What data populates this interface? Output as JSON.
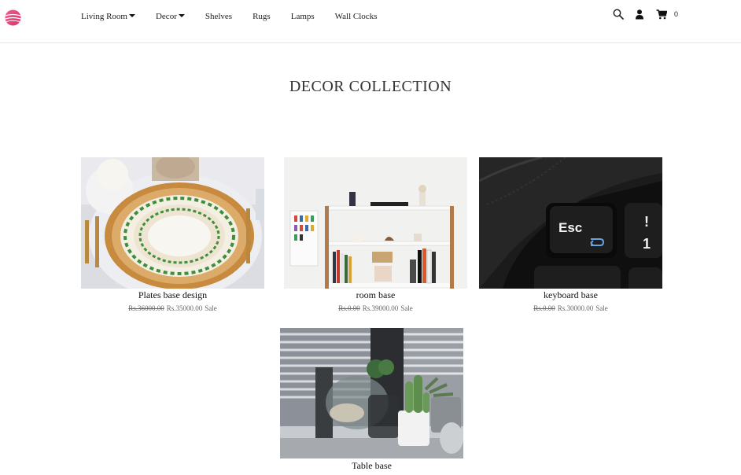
{
  "header": {
    "logo": "sphere-logo",
    "nav": [
      {
        "label": "Living Room",
        "dropdown": true
      },
      {
        "label": "Decor",
        "dropdown": true
      },
      {
        "label": "Shelves",
        "dropdown": false
      },
      {
        "label": "Rugs",
        "dropdown": false
      },
      {
        "label": "Lamps",
        "dropdown": false
      },
      {
        "label": "Wall Clocks",
        "dropdown": false
      }
    ],
    "icons": [
      "search-icon",
      "user-icon",
      "cart-icon"
    ],
    "cart_count": "0"
  },
  "page": {
    "title": "DECOR COLLECTION"
  },
  "products": [
    {
      "name": "Plates base design",
      "old_price": "Rs.36000.00",
      "price": "Rs.35000.00",
      "badge": "Sale",
      "image": "dinner-plates-photo"
    },
    {
      "name": "room base",
      "old_price": "Rs.0.00",
      "price": "Rs.39000.00",
      "badge": "Sale",
      "image": "bookshelf-photo"
    },
    {
      "name": "keyboard base",
      "old_price": "Rs.0.00",
      "price": "Rs.30000.00",
      "badge": "Sale",
      "image": "keyboard-esc-key-photo"
    },
    {
      "name": "Table base",
      "image": "cactus-plants-photo"
    }
  ],
  "colors": {
    "logo_pink": "#e8417c",
    "text": "#222222"
  }
}
